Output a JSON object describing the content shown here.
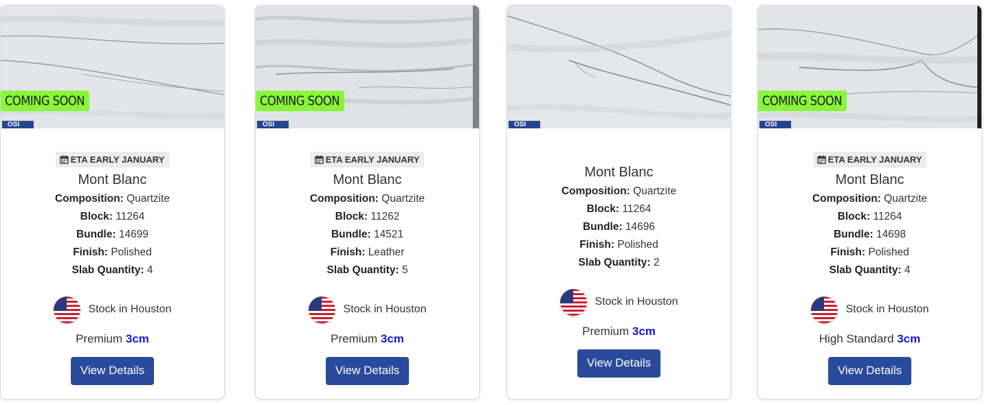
{
  "cards": [
    {
      "coming_soon": "COMING SOON",
      "logo": "OSI",
      "eta": "ETA EARLY JANUARY",
      "title": "Mont Blanc",
      "composition_label": "Composition:",
      "composition": "Quartzite",
      "block_label": "Block:",
      "block": "11262",
      "bundle_label": "Bundle:",
      "bundle": "14521",
      "finish_label": "Finish:",
      "finish": "Leather",
      "qty_label": "Slab Quantity:",
      "qty": "5",
      "stock": "Stock in Houston",
      "grade": "Premium",
      "thickness": "3cm",
      "button": "View Details"
    },
    {
      "logo": "OSI",
      "title": "Mont Blanc",
      "composition_label": "Composition:",
      "composition": "Quartzite",
      "block_label": "Block:",
      "block": "11264",
      "bundle_label": "Bundle:",
      "bundle": "14696",
      "finish_label": "Finish:",
      "finish": "Polished",
      "qty_label": "Slab Quantity:",
      "qty": "2",
      "stock": "Stock in Houston",
      "grade": "Premium",
      "thickness": "3cm",
      "button": "View Details"
    },
    {
      "coming_soon": "COMING SOON",
      "logo": "OSI",
      "eta": "ETA EARLY JANUARY",
      "title": "Mont Blanc",
      "composition_label": "Composition:",
      "composition": "Quartzite",
      "block_label": "Block:",
      "block": "11264",
      "bundle_label": "Bundle:",
      "bundle": "14698",
      "finish_label": "Finish:",
      "finish": "Polished",
      "qty_label": "Slab Quantity:",
      "qty": "4",
      "stock": "Stock in Houston",
      "grade": "High Standard",
      "thickness": "3cm",
      "button": "View Details"
    },
    {
      "coming_soon": "COMING SOON",
      "logo": "OSI",
      "eta": "ETA EARLY JANUARY",
      "title": "Mont Blanc",
      "composition_label": "Composition:",
      "composition": "Quartzite",
      "block_label": "Block:",
      "block": "11264",
      "bundle_label": "Bundle:",
      "bundle": "14699",
      "finish_label": "Finish:",
      "finish": "Polished",
      "qty_label": "Slab Quantity:",
      "qty": "4",
      "stock": "Stock in Houston",
      "grade": "Premium",
      "thickness": "3cm",
      "button": "View Details"
    }
  ],
  "colors": {
    "coming_soon_bg": "#88f53a",
    "button_bg": "#2a4a9b",
    "thickness_text": "#1a14e0",
    "eta_bg": "#ececec"
  },
  "icons": {
    "eta": "calendar-icon",
    "stock": "us-flag-icon"
  }
}
